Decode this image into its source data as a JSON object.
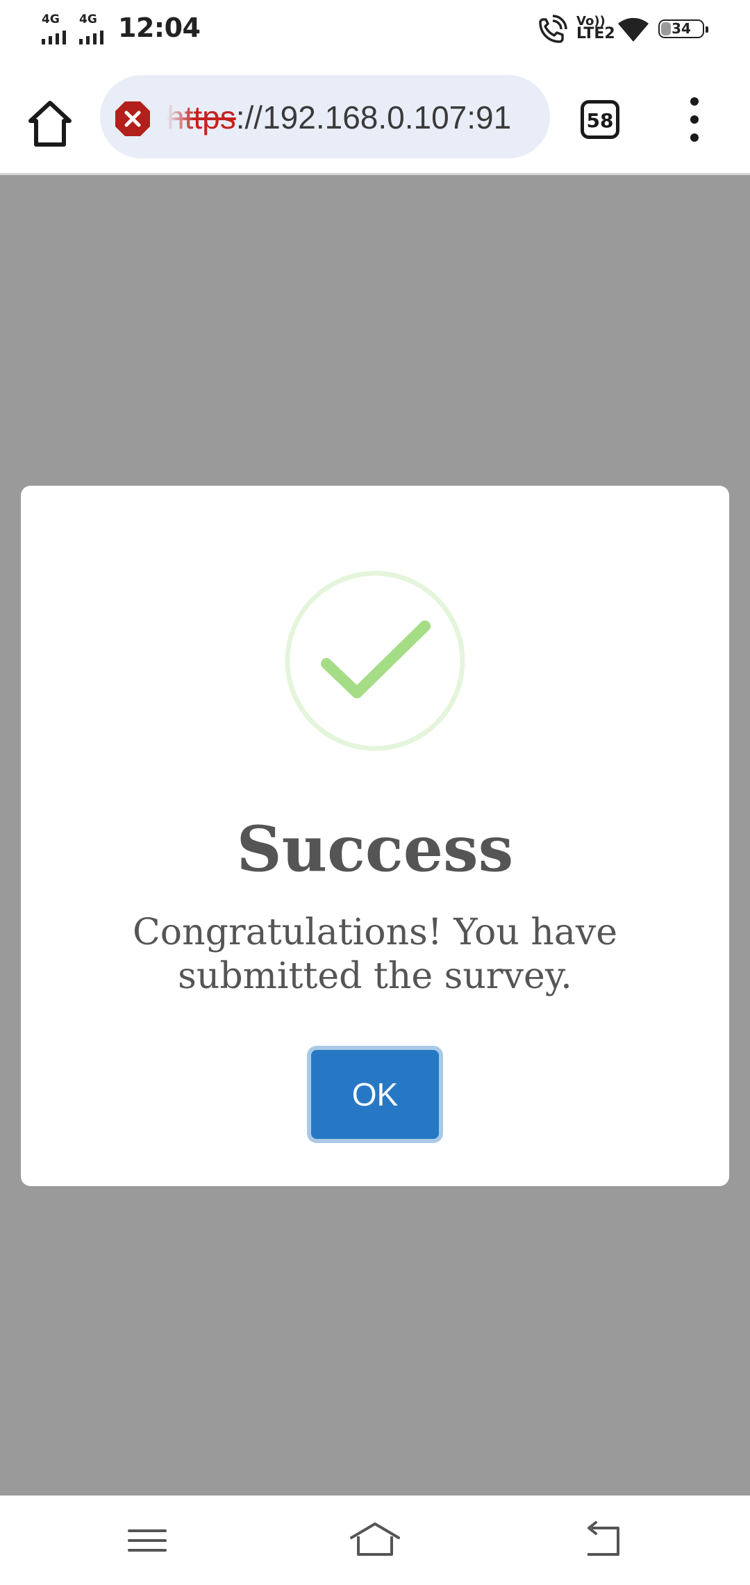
{
  "status_bar": {
    "network_1": "4G",
    "network_2": "4G",
    "time": "12:04",
    "volte_top": "Vo))",
    "volte_bottom": "LTE2",
    "battery_level": "34"
  },
  "browser": {
    "url_scheme": "https",
    "url_rest": "://192.168.0.107:91",
    "tab_count": "58",
    "security_state": "not-secure",
    "icons": [
      "home-icon",
      "not-secure-icon",
      "tabs-icon",
      "more-vert-icon"
    ]
  },
  "dialog": {
    "title": "Success",
    "message": "Congratulations! You have submitted the survey.",
    "ok_label": "OK",
    "success_color": "#a5dc86",
    "button_color": "#2778c4"
  },
  "nav_bar": {
    "icons": [
      "menu-icon",
      "home-icon",
      "back-icon"
    ]
  }
}
